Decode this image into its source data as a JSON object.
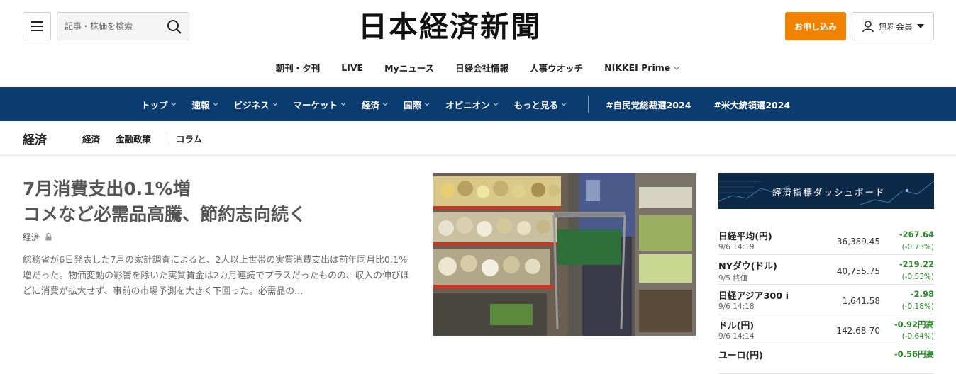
{
  "header": {
    "search_placeholder": "記事・株価を検索",
    "logo": "日本経済新聞",
    "signup_label": "お申し込み",
    "member_label": "無料会員"
  },
  "sublinks": [
    "朝刊・夕刊",
    "LIVE",
    "Myニュース",
    "日経会社情報",
    "人事ウオッチ",
    "NIKKEI Prime"
  ],
  "nav": {
    "items": [
      "トップ",
      "速報",
      "ビジネス",
      "マーケット",
      "経済",
      "国際",
      "オピニオン",
      "もっと見る"
    ],
    "tags": [
      "#自民党総裁選2024",
      "#米大統領選2024"
    ]
  },
  "section": {
    "title": "経済",
    "links": [
      "経済",
      "金融政策",
      "コラム"
    ]
  },
  "article": {
    "headline_line1": "7月消費支出0.1%増",
    "headline_line2": "コメなど必需品高騰、節約志向続く",
    "tag": "経済",
    "summary": "総務省が6日発表した7月の家計調査によると、2人以上世帯の実質消費支出は前年同月比0.1%増だった。物価変動の影響を除いた実質賃金は2カ月連続でプラスだったものの、収入の伸びほどに消費が拡大せず、事前の市場予測を大きく下回った。必需品の..."
  },
  "dashboard": {
    "title": "経済指標ダッシュボード",
    "markets": [
      {
        "name": "日経平均(円)",
        "time": "9/6 14:19",
        "value": "36,389.45",
        "change": "-267.64",
        "pct": "(-0.73%)"
      },
      {
        "name": "NYダウ(ドル)",
        "time": "9/5 終値",
        "value": "40,755.75",
        "change": "-219.22",
        "pct": "(-0.53%)"
      },
      {
        "name": "日経アジア300 i",
        "time": "9/6 14:18",
        "value": "1,641.58",
        "change": "-2.98",
        "pct": "(-0.18%)"
      },
      {
        "name": "ドル(円)",
        "time": "9/6 14:14",
        "value": "142.68-70",
        "change": "-0.92円高",
        "pct": "(-0.64%)"
      },
      {
        "name": "ユーロ(円)",
        "time": "",
        "value": "",
        "change": "-0.56円高",
        "pct": ""
      }
    ]
  },
  "colors": {
    "nav_bg": "#0b3c6f",
    "signup_bg": "#f08200",
    "positive_green": "#2a8a2a"
  }
}
